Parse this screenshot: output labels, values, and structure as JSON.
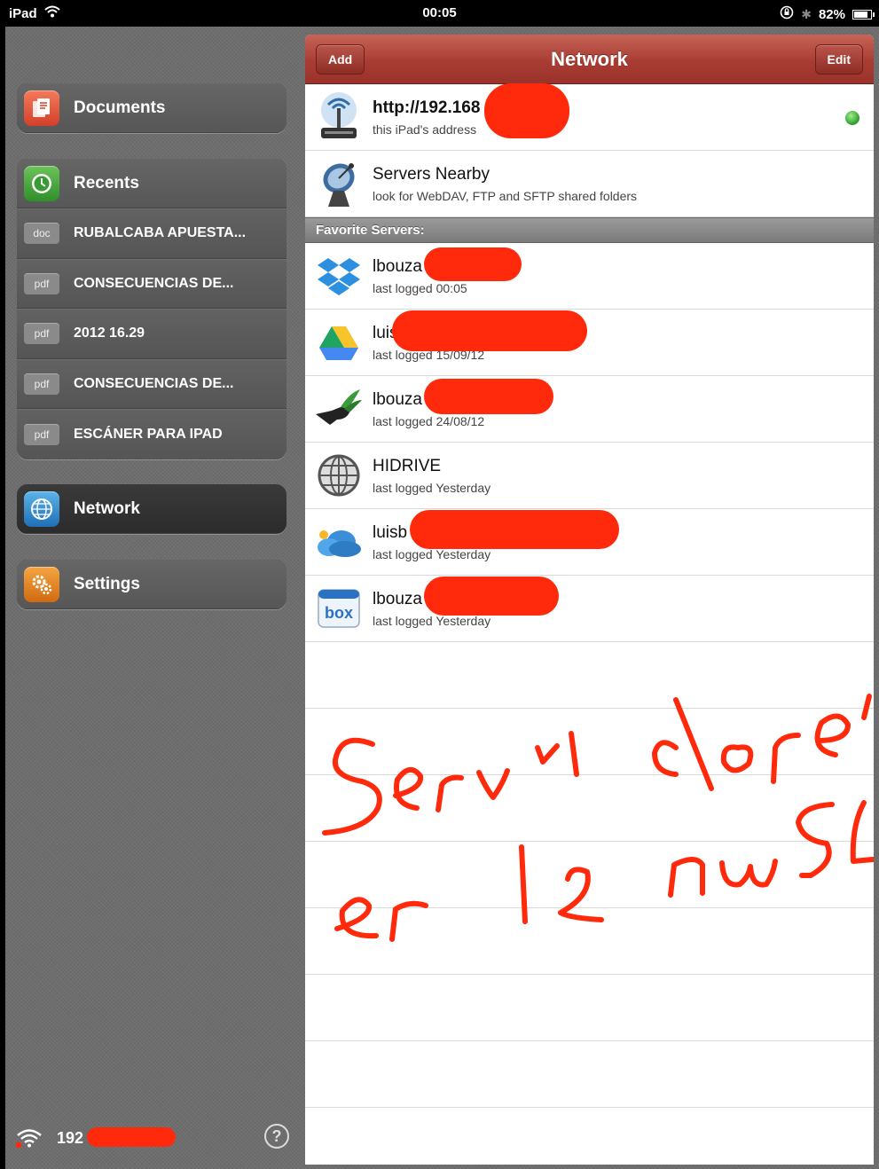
{
  "status_bar": {
    "device": "iPad",
    "time": "00:05",
    "battery": "82%",
    "battery_level": 0.82
  },
  "sidebar": {
    "documents": {
      "label": "Documents",
      "icon": "documents-icon"
    },
    "recents": {
      "label": "Recents",
      "icon": "clock-icon",
      "items": [
        {
          "type": "doc",
          "name": "RUBALCABA APUESTA..."
        },
        {
          "type": "pdf",
          "name": "CONSECUENCIAS DE..."
        },
        {
          "type": "pdf",
          "name": "2012 16.29"
        },
        {
          "type": "pdf",
          "name": "CONSECUENCIAS DE..."
        },
        {
          "type": "pdf",
          "name": "ESCÁNER PARA IPAD"
        }
      ]
    },
    "network": {
      "label": "Network",
      "icon": "globe-icon"
    },
    "settings": {
      "label": "Settings",
      "icon": "gear-icon"
    },
    "footer": {
      "ip": "192",
      "help": "?"
    }
  },
  "navbar": {
    "title": "Network",
    "add_label": "Add",
    "edit_label": "Edit"
  },
  "top_cells": [
    {
      "title": "http://192.168",
      "subtitle": "this iPad's address",
      "icon": "wifi-antenna-icon",
      "status": "online"
    },
    {
      "title": "Servers Nearby",
      "subtitle": "look for WebDAV, FTP and SFTP shared folders",
      "icon": "satellite-dish-icon"
    }
  ],
  "section_header": "Favorite Servers:",
  "favorites": [
    {
      "title": "lbouza",
      "subtitle": "last logged 00:05",
      "icon": "dropbox-icon"
    },
    {
      "title": "luis",
      "subtitle": "last logged 15/09/12",
      "icon": "google-drive-icon"
    },
    {
      "title": "lbouza",
      "subtitle": "last logged 24/08/12",
      "icon": "hummingbird-icon"
    },
    {
      "title": "HIDRIVE",
      "subtitle": "last logged Yesterday",
      "icon": "globe-icon"
    },
    {
      "title": "luisb",
      "subtitle": "last logged Yesterday",
      "icon": "skydrive-cloud-icon"
    },
    {
      "title": "lbouza",
      "subtitle": "last logged Yesterday",
      "icon": "box-icon"
    }
  ],
  "colors": {
    "navbar": "#a83c33",
    "redaction": "#ff2a0c",
    "online": "#2c9a2a"
  }
}
